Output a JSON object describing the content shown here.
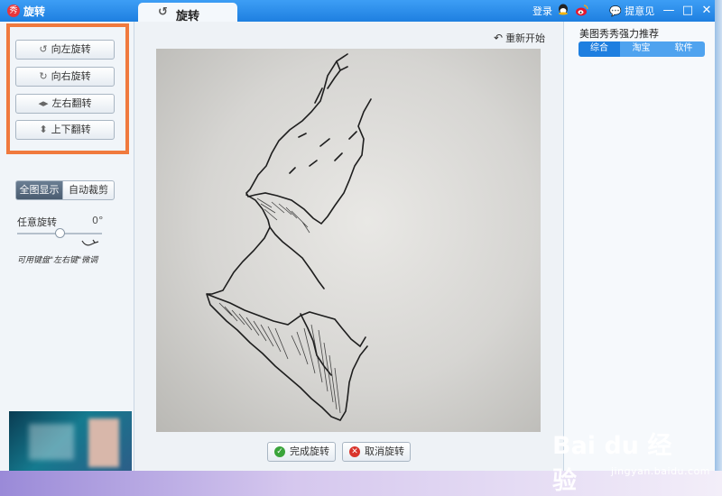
{
  "app": {
    "logo_text": "秀",
    "title": "旋转"
  },
  "tab": {
    "label": "旋转",
    "icon": "rotate-ccw-icon"
  },
  "header": {
    "login": "登录",
    "feedback": "提意见"
  },
  "window_controls": {
    "minimize": "—",
    "maximize": "□",
    "close": "✕"
  },
  "left": {
    "buttons": [
      {
        "label": "向左旋转",
        "icon": "rotate-left-icon"
      },
      {
        "label": "向右旋转",
        "icon": "rotate-right-icon"
      },
      {
        "label": "左右翻转",
        "icon": "flip-horizontal-icon"
      },
      {
        "label": "上下翻转",
        "icon": "flip-vertical-icon"
      }
    ],
    "view_mode": {
      "full": "全图显示",
      "auto_crop": "自动裁剪",
      "selected": "全图显示"
    },
    "rotation_label": "任意旋转",
    "rotation_value": "0°",
    "rotation_slider_fraction": 0.5,
    "hint": "可用键盘\"左右键\"微调"
  },
  "center": {
    "restart_label": "重新开始",
    "ok_label": "完成旋转",
    "cancel_label": "取消旋转"
  },
  "right": {
    "title": "美图秀秀强力推荐",
    "tabs": [
      "综合",
      "淘宝",
      "软件"
    ],
    "selected_tab": "综合"
  },
  "watermark": {
    "logo": "Bai du 经验",
    "url": "jingyan.baidu.com"
  },
  "colors": {
    "titlebar": "#1e7fe0",
    "highlight_frame": "#f07a3e",
    "ok_icon": "#3aa43a",
    "cancel_icon": "#d9342b"
  }
}
